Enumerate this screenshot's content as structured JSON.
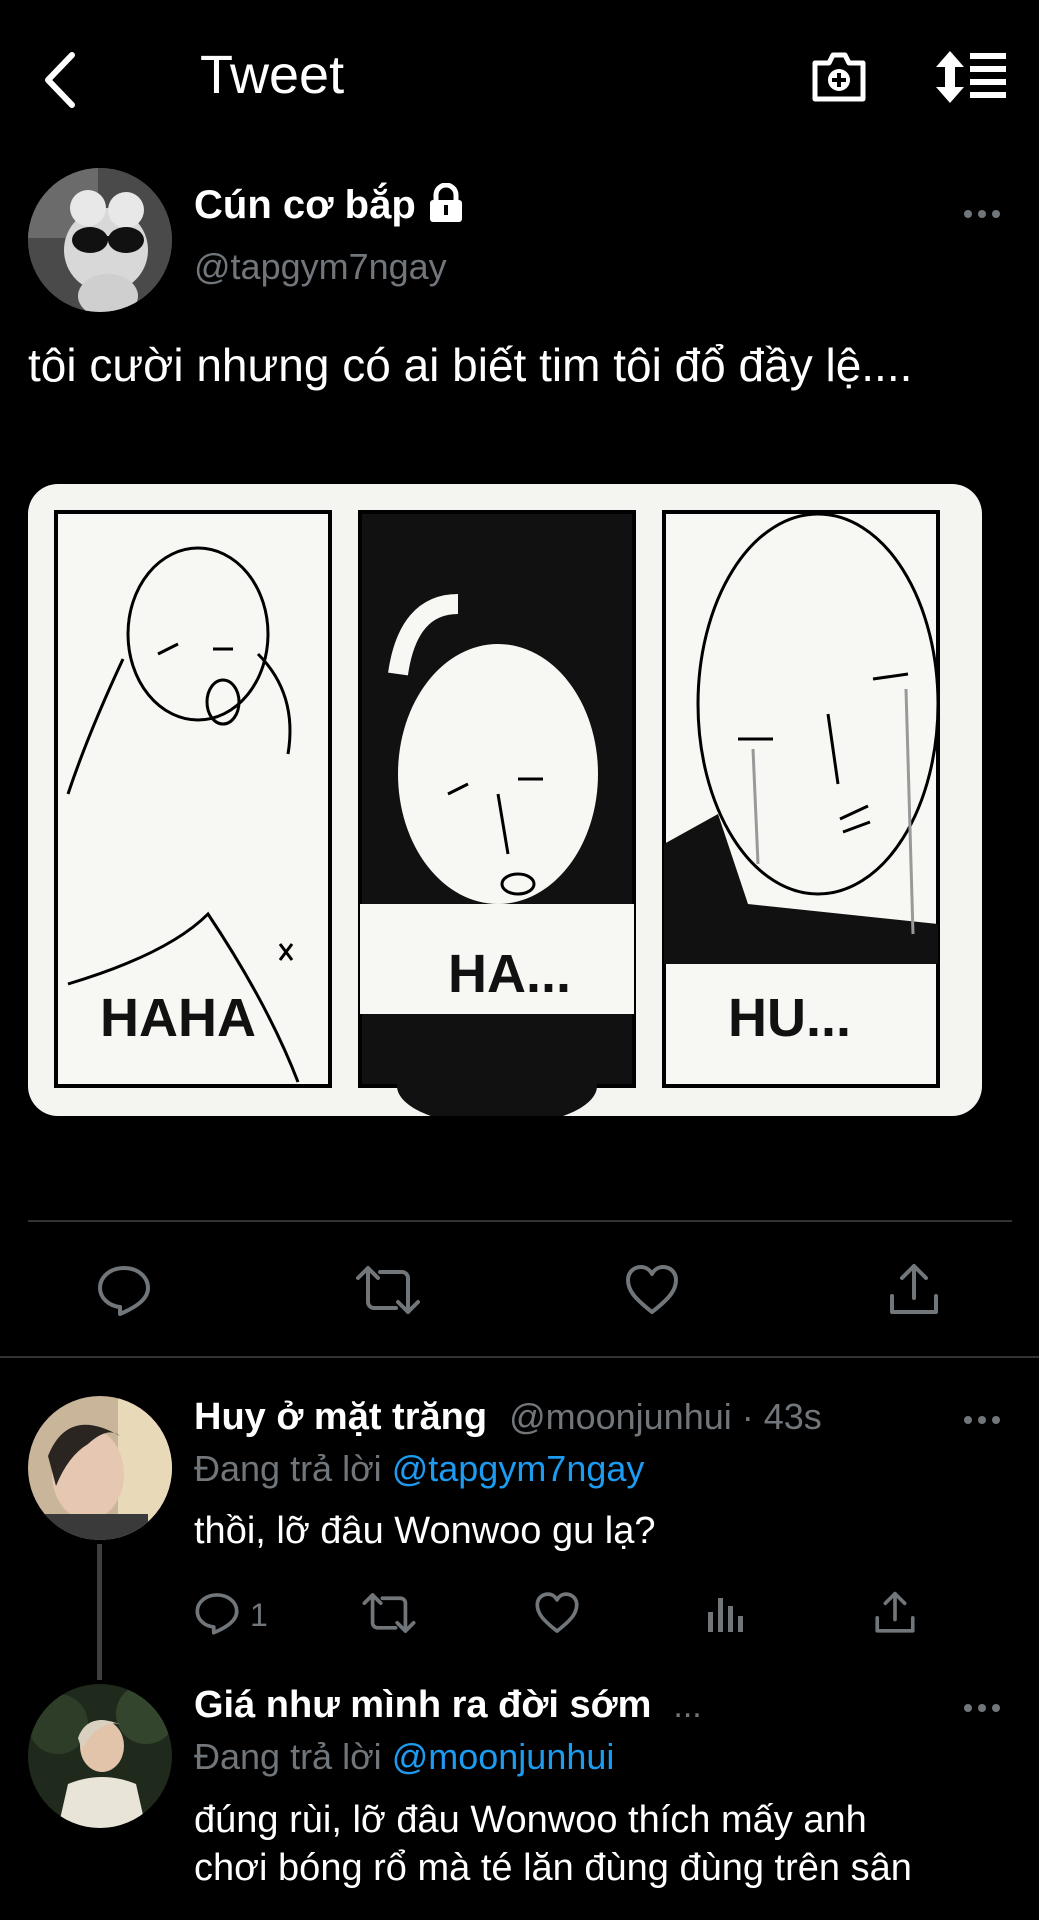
{
  "header": {
    "title": "Tweet",
    "back_icon": "back-arrow-icon",
    "camera_icon": "camera-plus-icon",
    "sort_icon": "sort-icon"
  },
  "tweet": {
    "display_name": "Cún cơ bắp",
    "handle": "@tapgym7ngay",
    "protected_icon": "lock-icon",
    "text": "tôi cười nhưng có ai biết tim tôi đổ đầy lệ....",
    "image": {
      "panels": [
        "HAHA",
        "HA...",
        "HU..."
      ]
    },
    "more_icon": "more-icon"
  },
  "actions": [
    "reply-icon",
    "retweet-icon",
    "like-icon",
    "share-icon"
  ],
  "replies": [
    {
      "display_name": "Huy ở mặt trăng",
      "handle_time": "@moonjunhui · 43s",
      "replying_prefix": "Đang trả lời",
      "replying_to": "@tapgym7ngay",
      "text": "thồi, lỡ đâu Wonwoo gu lạ?",
      "reply_count": "1"
    },
    {
      "display_name": "Giá như mình ra đời sớm",
      "ellipsis": "...",
      "replying_prefix": "Đang trả lời",
      "replying_to": "@moonjunhui",
      "text_line1": "đúng rùi, lỡ đâu Wonwoo thích mấy anh",
      "text_line2": "chơi bóng rổ mà té lăn đùng đùng trên sân"
    }
  ],
  "colors": {
    "background": "#000000",
    "text": "#e7e9ea",
    "muted": "#71767b",
    "link": "#1d9bf0",
    "divider": "#2f3336"
  }
}
